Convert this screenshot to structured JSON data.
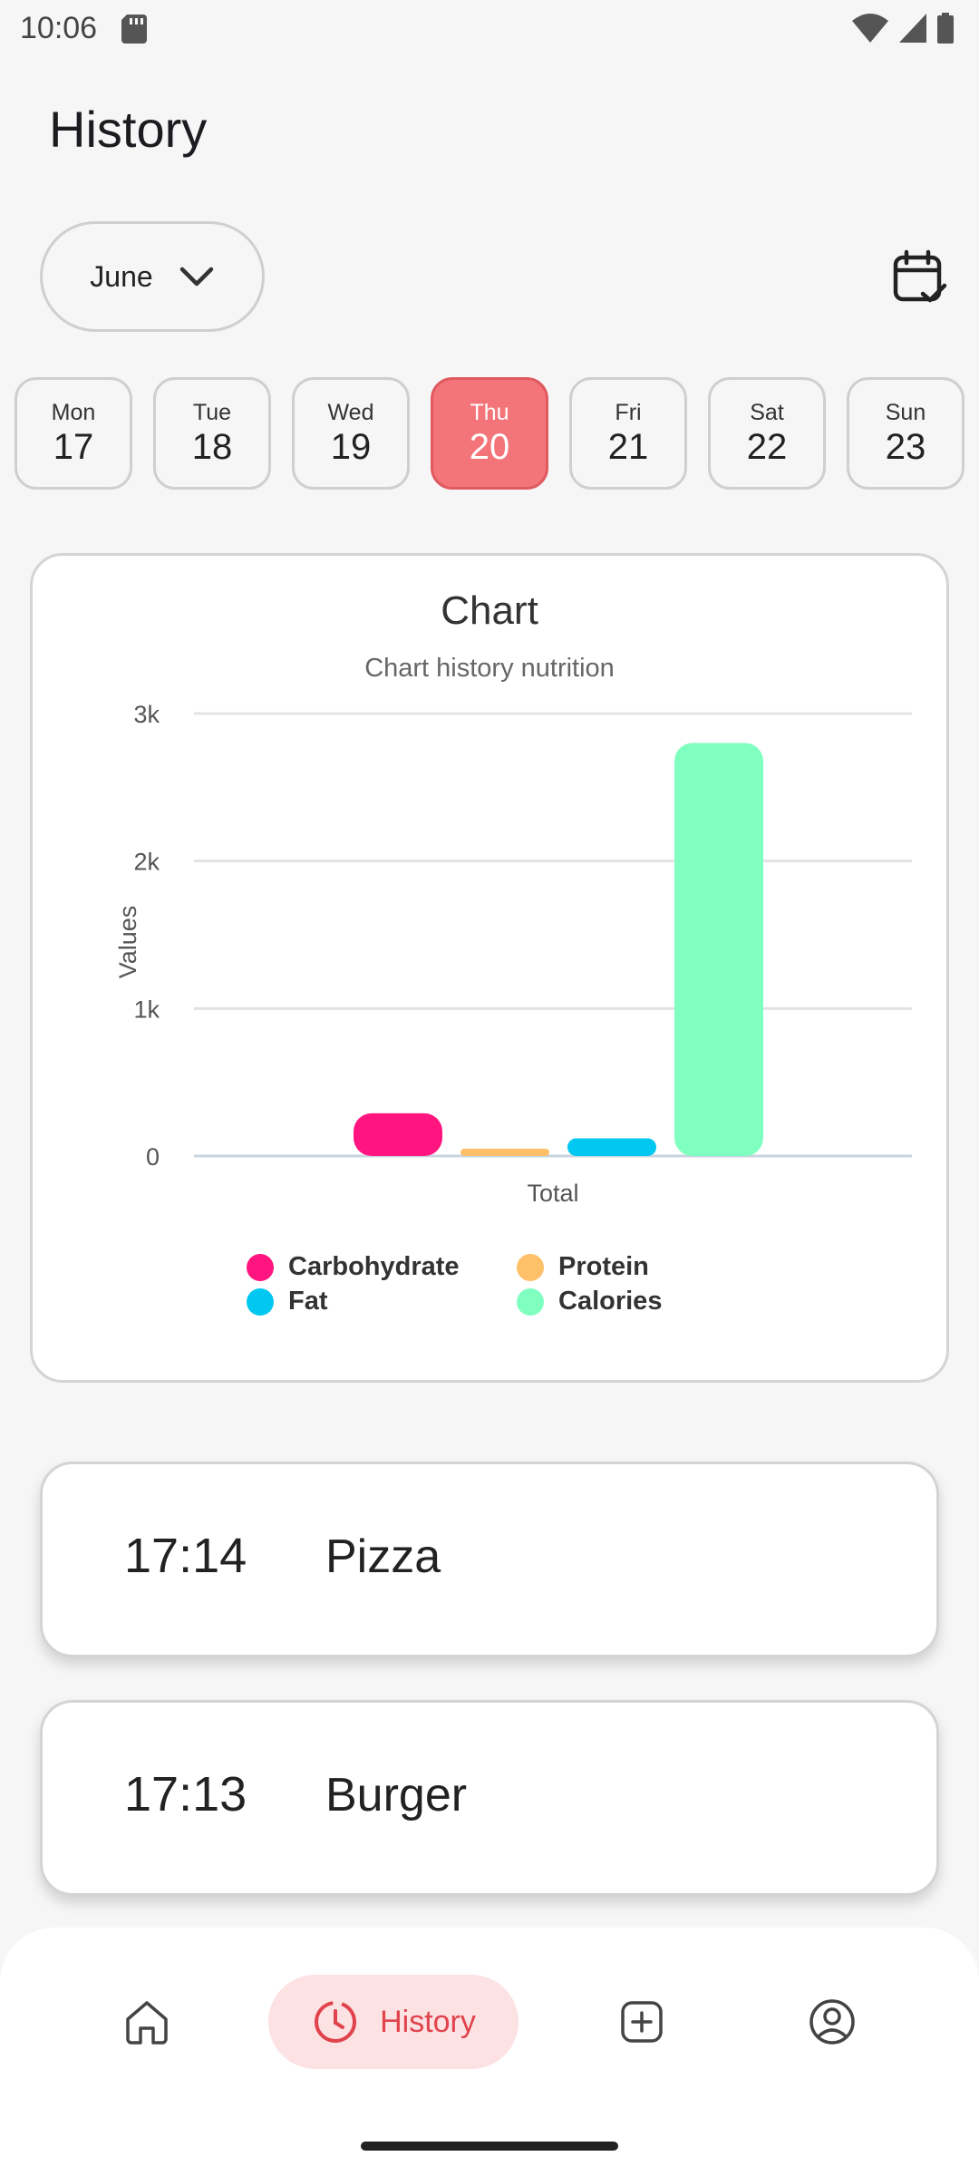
{
  "status_bar": {
    "time": "10:06"
  },
  "header": {
    "title": "History"
  },
  "month_selector": {
    "value": "June"
  },
  "days": [
    {
      "name": "Mon",
      "num": "17",
      "selected": false
    },
    {
      "name": "Tue",
      "num": "18",
      "selected": false
    },
    {
      "name": "Wed",
      "num": "19",
      "selected": false
    },
    {
      "name": "Thu",
      "num": "20",
      "selected": true
    },
    {
      "name": "Fri",
      "num": "21",
      "selected": false
    },
    {
      "name": "Sat",
      "num": "22",
      "selected": false
    },
    {
      "name": "Sun",
      "num": "23",
      "selected": false
    }
  ],
  "colors": {
    "accent": "#f37479",
    "nav_active_bg": "#fde2e3",
    "nav_active": "#e0434c",
    "carbohydrate": "#ff1480",
    "protein": "#ffc06a",
    "fat": "#00c8f0",
    "calories": "#7fffc0"
  },
  "chart_data": {
    "type": "bar",
    "title": "Chart",
    "subtitle": "Chart history nutrition",
    "categories": [
      "Total"
    ],
    "xlabel": "Total",
    "ylabel": "Values",
    "ylim": [
      0,
      3000
    ],
    "yticks": [
      "0",
      "1k",
      "2k",
      "3k"
    ],
    "ytick_values": [
      0,
      1000,
      2000,
      3000
    ],
    "grid": true,
    "legend_position": "bottom",
    "series": [
      {
        "name": "Carbohydrate",
        "values": [
          290
        ],
        "color": "#ff1480"
      },
      {
        "name": "Protein",
        "values": [
          50
        ],
        "color": "#ffc06a"
      },
      {
        "name": "Fat",
        "values": [
          120
        ],
        "color": "#00c8f0"
      },
      {
        "name": "Calories",
        "values": [
          2800
        ],
        "color": "#7fffc0"
      }
    ]
  },
  "entries": [
    {
      "time": "17:14",
      "name": "Pizza"
    },
    {
      "time": "17:13",
      "name": "Burger"
    }
  ],
  "nav": {
    "home_icon": "home-icon",
    "history_label": "History",
    "history_icon": "clock-history-icon",
    "add_icon": "add-square-icon",
    "profile_icon": "profile-icon"
  }
}
